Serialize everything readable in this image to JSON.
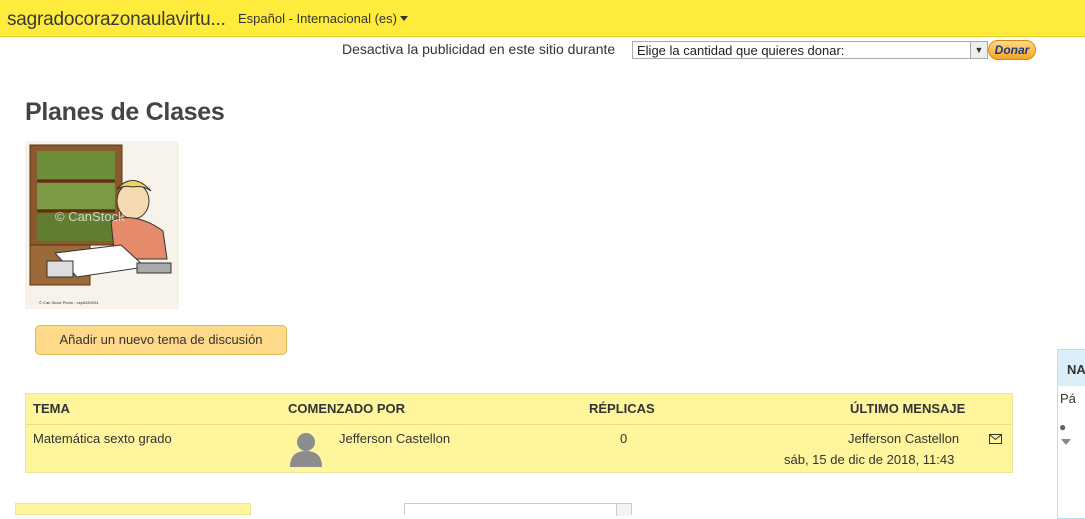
{
  "header": {
    "site_name": "sagradocorazonaulavirtu...",
    "language": "Español - Internacional (es)"
  },
  "donation": {
    "text": "Desactiva la publicidad en este sitio durante",
    "select_value": "Elige la cantidad que quieres donar:",
    "button_label": "Donar"
  },
  "page": {
    "title": "Planes de Clases",
    "image_caption": "© Can Stock Photo - csp6330204",
    "watermark": "© CanStock",
    "add_button_label": "Añadir un nuevo tema de discusión"
  },
  "table": {
    "columns": [
      "TEMA",
      "COMENZADO POR",
      "RÉPLICAS",
      "ÚLTIMO MENSAJE"
    ],
    "rows": [
      {
        "topic": "Matemática sexto grado",
        "started_by": "Jefferson Castellon",
        "replies": "0",
        "last_author": "Jefferson Castellon",
        "last_date": "sáb, 15 de dic de 2018, 11:43"
      }
    ]
  },
  "side_block": {
    "heading": "NA",
    "line1": "Pá"
  },
  "icons": {
    "language_caret": "caret-down-icon",
    "select_arrow": "chevron-down-icon",
    "avatar": "user-avatar-icon",
    "mail": "envelope-icon"
  },
  "colors": {
    "topbar": "#ffeb3b",
    "table_bg": "#fff59d",
    "button_bg": "#ffd98a",
    "side_head": "#d9eef8"
  }
}
